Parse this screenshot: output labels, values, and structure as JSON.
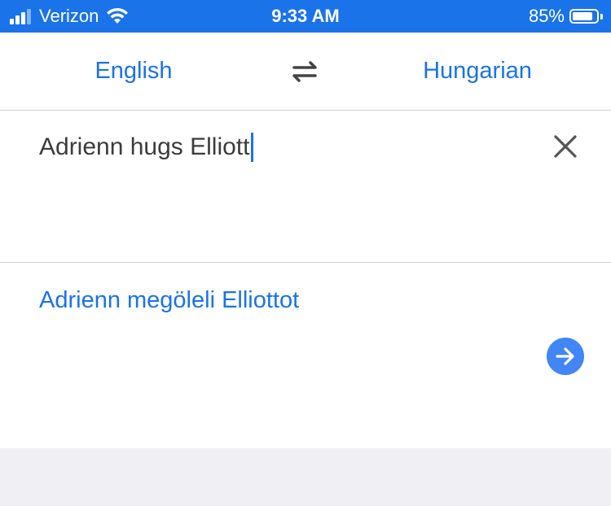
{
  "status_bar": {
    "carrier": "Verizon",
    "time": "9:33 AM",
    "battery_percent": "85%",
    "battery_level": 0.85,
    "signal_bars": 3,
    "background_color": "#1a73e8"
  },
  "language_bar": {
    "source_language": "English",
    "target_language": "Hungarian",
    "swap_icon": "swap-arrows-icon"
  },
  "input": {
    "text": "Adrienn hugs Elliott",
    "clear_icon": "close-icon"
  },
  "output": {
    "translation": "Adrienn megöleli Elliottot",
    "go_icon": "arrow-right-icon"
  },
  "colors": {
    "accent": "#1a73e8",
    "text": "#3c3c3c",
    "divider": "#d0d0d0"
  }
}
